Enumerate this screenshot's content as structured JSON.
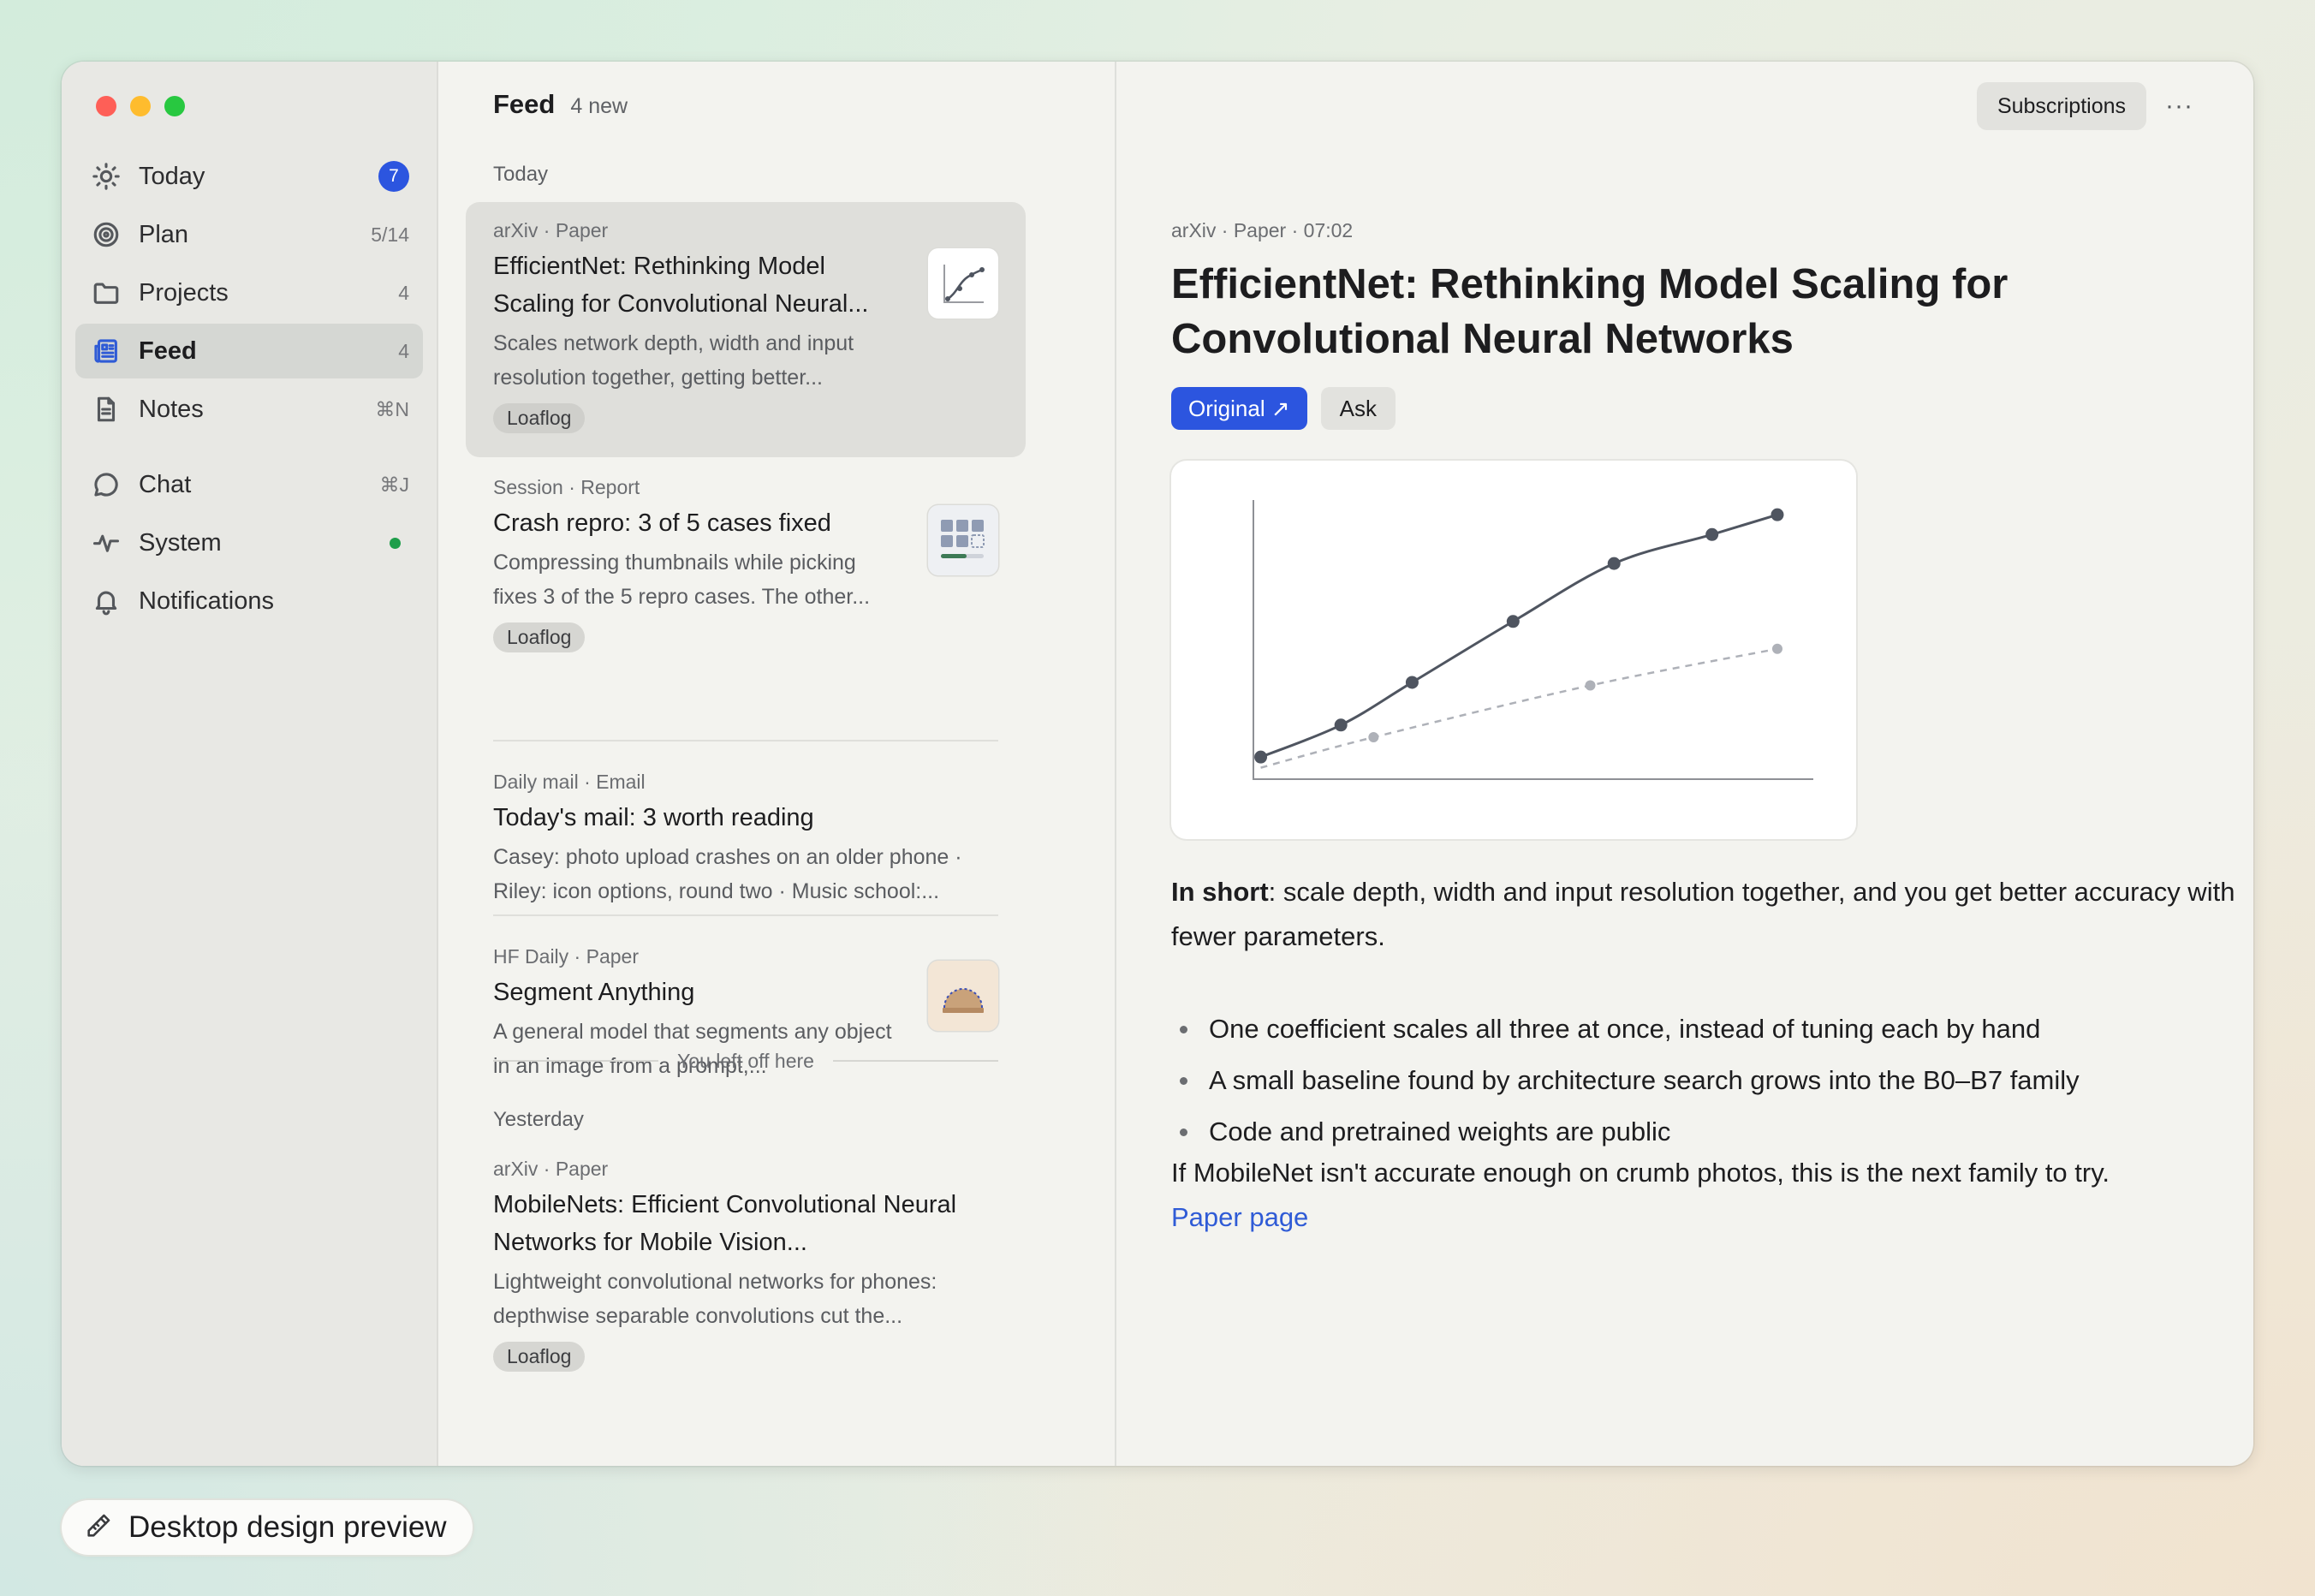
{
  "window": {
    "controls": [
      "close",
      "minimize",
      "zoom"
    ]
  },
  "sidebar": {
    "items": [
      {
        "label": "Today",
        "icon": "sun-icon",
        "badge": "7"
      },
      {
        "label": "Plan",
        "icon": "target-icon",
        "count": "5/14"
      },
      {
        "label": "Projects",
        "icon": "folder-icon",
        "count": "4"
      },
      {
        "label": "Feed",
        "icon": "newspaper-icon",
        "count": "4",
        "active": true
      },
      {
        "label": "Notes",
        "icon": "note-icon",
        "shortcut": "⌘N"
      },
      {
        "label": "Chat",
        "icon": "chat-bubble-icon",
        "shortcut": "⌘J"
      },
      {
        "label": "System",
        "icon": "pulse-icon",
        "status": "green"
      },
      {
        "label": "Notifications",
        "icon": "bell-icon"
      }
    ]
  },
  "feed": {
    "title": "Feed",
    "new_count": "4 new",
    "sections": {
      "today": "Today",
      "yesterday": "Yesterday"
    },
    "left_off": "You left off here",
    "items": [
      {
        "meta": "arXiv · Paper",
        "title": "EfficientNet: Rethinking Model Scaling for Convolutional Neural...",
        "desc": "Scales network depth, width and input resolution together, getting better...",
        "tag": "Loaflog",
        "thumb": "line-chart-thumbnail"
      },
      {
        "meta": "Session · Report",
        "title": "Crash repro: 3 of 5 cases fixed",
        "desc": "Compressing thumbnails while picking fixes 3 of the 5 repro cases. The other...",
        "tag": "Loaflog",
        "thumb": "grid-progress-thumbnail"
      },
      {
        "meta": "Daily mail · Email",
        "title": "Today's mail: 3 worth reading",
        "desc": "Casey: photo upload crashes on an older phone · Riley: icon options, round two · Music school:..."
      },
      {
        "meta": "HF Daily · Paper",
        "title": "Segment Anything",
        "desc": "A general model that segments any object in an image from a prompt,...",
        "thumb": "segmented-dome-thumbnail"
      },
      {
        "meta": "arXiv · Paper",
        "title": "MobileNets: Efficient Convolutional Neural Networks for Mobile Vision...",
        "desc": "Lightweight convolutional networks for phones: depthwise separable convolutions cut the...",
        "tag": "Loaflog"
      }
    ]
  },
  "detail": {
    "subscriptions_label": "Subscriptions",
    "more_label": "···",
    "meta": "arXiv · Paper · 07:02",
    "title": "EfficientNet: Rethinking Model Scaling for Convolutional Neural Networks",
    "original_label": "Original ↗",
    "ask_label": "Ask",
    "summary_lead": "In short",
    "summary_rest": ": scale depth, width and input resolution together, and you get better accuracy with fewer parameters.",
    "bullets": [
      "One coefficient scales all three at once, instead of tuning each by hand",
      "A small baseline found by architecture search grows into the B0–B7 family",
      "Code and pretrained weights are public"
    ],
    "closing": "If MobileNet isn't accurate enough on crumb photos, this is the next family to try.",
    "link_label": "Paper page"
  },
  "chart_data": {
    "type": "line",
    "title": "",
    "xlabel": "",
    "ylabel": "",
    "grid": false,
    "xlim": [
      0,
      100
    ],
    "ylim": [
      0,
      100
    ],
    "series": [
      {
        "style": "solid",
        "color": "#4f5560",
        "x": [
          7,
          20.5,
          32.5,
          49.5,
          66.5,
          83,
          94
        ],
        "y": [
          9.5,
          20,
          34,
          54,
          73,
          82.5,
          89
        ]
      },
      {
        "style": "dashed",
        "color": "#aeb1b8",
        "x": [
          26,
          62.5,
          94
        ],
        "y": [
          16,
          33,
          45
        ]
      }
    ]
  },
  "preview_pill": {
    "label": "Desktop design preview",
    "icon": "pencil-icon"
  }
}
